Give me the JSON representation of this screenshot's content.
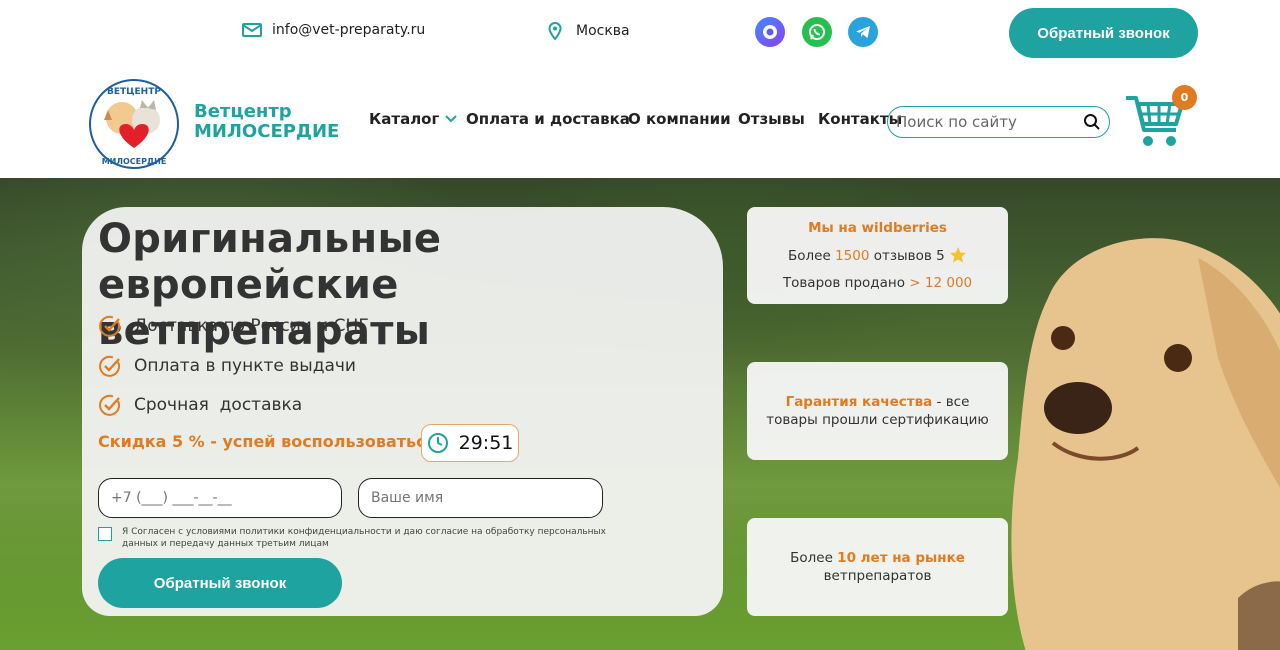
{
  "topbar": {
    "email": "info@vet-preparaty.ru",
    "city": "Москва",
    "socials": [
      "max-icon",
      "whatsapp-icon",
      "telegram-icon"
    ],
    "callback_label": "Обратный звонок"
  },
  "header": {
    "logo_line1": "Ветцентр",
    "logo_line2": "МИЛОСЕРДИЕ",
    "logo_badge_top": "ВЕТЦЕНТР",
    "logo_badge_bottom": "МИЛОСЕРДИЕ",
    "nav": {
      "catalog": "Каталог",
      "payment": "Оплата и доставка",
      "about": "О компании",
      "reviews": "Отзывы",
      "contacts": "Контакты"
    },
    "search_placeholder": "Поиск по сайту",
    "cart_count": "0"
  },
  "hero": {
    "title": "Оригинальные европейские ветпрепараты",
    "features": [
      "Доставка по России и СНГ",
      "Оплата в пункте выдачи",
      "Срочная  доставка"
    ],
    "discount": "Скидка 5 % - успей воспользоваться",
    "timer": "29:51",
    "phone_placeholder": "+7 (___) ___-__-__",
    "name_placeholder": "Ваше имя",
    "consent": "Я Согласен с условиями политики конфиденциальности и даю согласие на обработку персональных данных и передачу данных третьим лицам",
    "callback_label": "Обратный звонок"
  },
  "info_cards": {
    "wb_title": "Мы на wildberries",
    "wb_reviews_prefix": "Более ",
    "wb_reviews_count": "1500",
    "wb_reviews_suffix": " отзывов 5",
    "wb_sold_prefix": "Товаров продано ",
    "wb_sold_value": "> 12 000",
    "quality_bold": "Гарантия качества",
    "quality_rest": " - все товары прошли сертификацию",
    "years_prefix": "Более ",
    "years_bold": "10 лет на рынке",
    "years_rest": "ветпрепаратов"
  },
  "colors": {
    "accent": "#1fa3a0",
    "orange": "#e07b22"
  }
}
